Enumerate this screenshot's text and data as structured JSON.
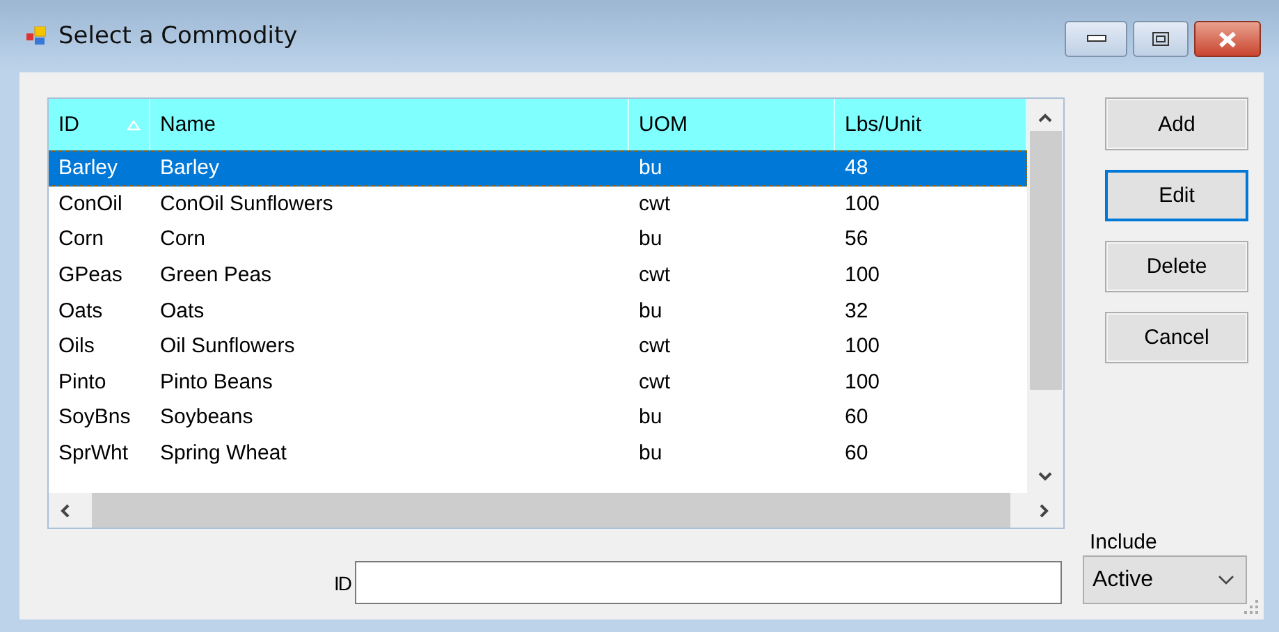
{
  "window": {
    "title": "Select a Commodity"
  },
  "table": {
    "columns": [
      {
        "label": "ID",
        "sorted": true
      },
      {
        "label": "Name",
        "sorted": false
      },
      {
        "label": "UOM",
        "sorted": false
      },
      {
        "label": "Lbs/Unit",
        "sorted": false
      }
    ],
    "rows": [
      {
        "cells": [
          "Barley",
          "Barley",
          "bu",
          "48"
        ],
        "selected": true
      },
      {
        "cells": [
          "ConOil",
          "ConOil Sunflowers",
          "cwt",
          "100"
        ],
        "selected": false
      },
      {
        "cells": [
          "Corn",
          "Corn",
          "bu",
          "56"
        ],
        "selected": false
      },
      {
        "cells": [
          "GPeas",
          "Green Peas",
          "cwt",
          "100"
        ],
        "selected": false
      },
      {
        "cells": [
          "Oats",
          "Oats",
          "bu",
          "32"
        ],
        "selected": false
      },
      {
        "cells": [
          "Oils",
          "Oil Sunflowers",
          "cwt",
          "100"
        ],
        "selected": false
      },
      {
        "cells": [
          "Pinto",
          "Pinto Beans",
          "cwt",
          "100"
        ],
        "selected": false
      },
      {
        "cells": [
          "SoyBns",
          "Soybeans",
          "bu",
          "60"
        ],
        "selected": false
      },
      {
        "cells": [
          "SprWht",
          "Spring Wheat",
          "bu",
          "60"
        ],
        "selected": false
      }
    ]
  },
  "buttons": [
    {
      "label": "Add",
      "focused": false
    },
    {
      "label": "Edit",
      "focused": true
    },
    {
      "label": "Delete",
      "focused": false
    },
    {
      "label": "Cancel",
      "focused": false
    }
  ],
  "id_field": {
    "label": "ID"
  },
  "include": {
    "label": "Include",
    "value": "Active"
  }
}
